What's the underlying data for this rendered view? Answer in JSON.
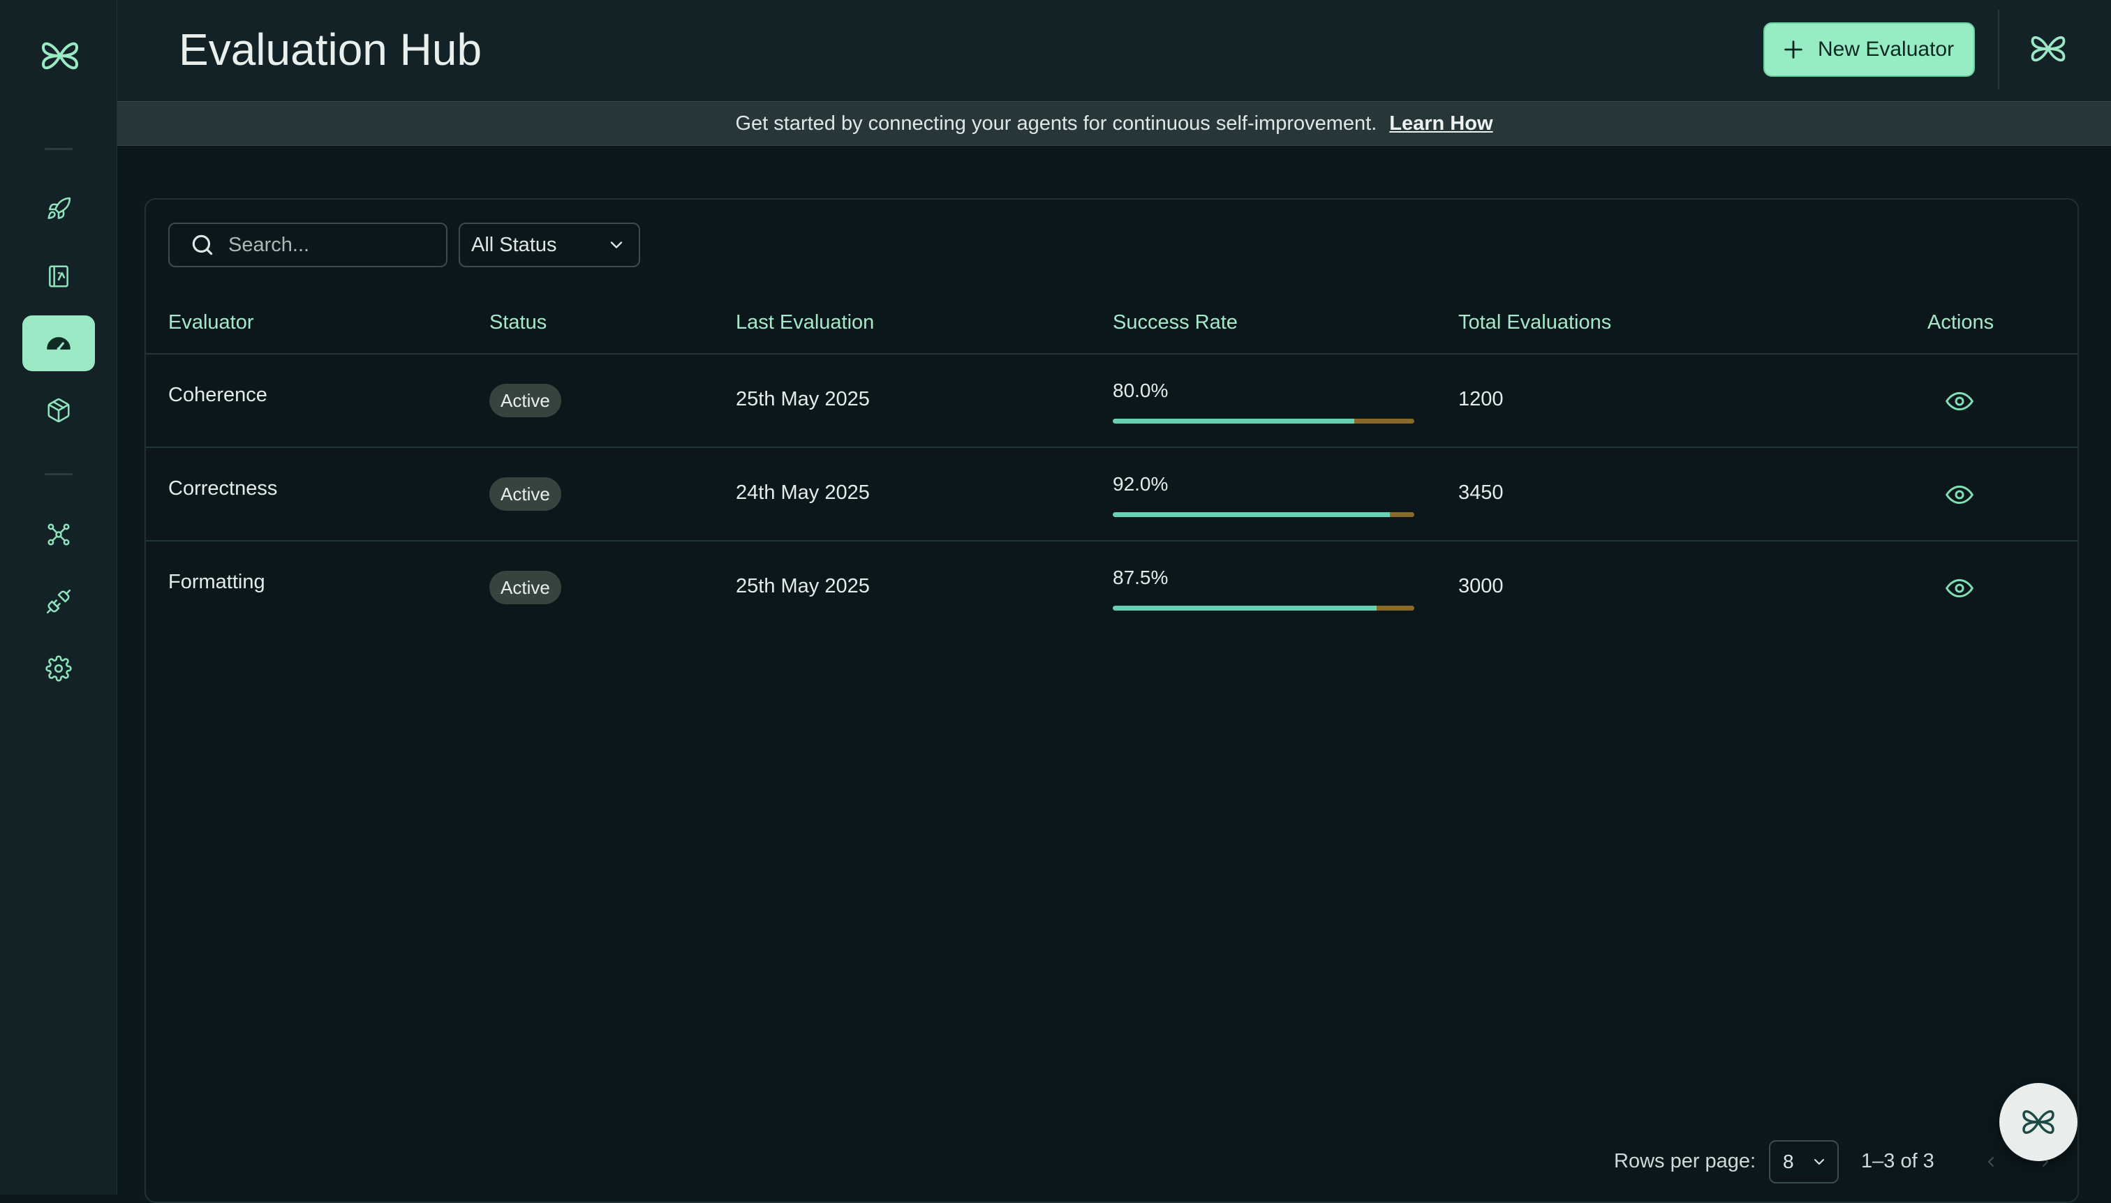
{
  "header": {
    "title": "Evaluation Hub",
    "new_button_label": "New Evaluator"
  },
  "banner": {
    "text": "Get started by connecting your agents for continuous self-improvement.",
    "link_label": "Learn How"
  },
  "sidebar": {
    "items": [
      {
        "name": "rocket",
        "icon": "rocket-icon",
        "active": false
      },
      {
        "name": "notebook",
        "icon": "notebook-icon",
        "active": false
      },
      {
        "name": "evaluation",
        "icon": "gauge-icon",
        "active": true
      },
      {
        "name": "packages",
        "icon": "cube-icon",
        "active": false
      },
      {
        "name": "graph",
        "icon": "nodes-icon",
        "active": false
      },
      {
        "name": "integrations",
        "icon": "plug-icon",
        "active": false
      },
      {
        "name": "settings",
        "icon": "gear-icon",
        "active": false
      }
    ]
  },
  "filters": {
    "search_placeholder": "Search...",
    "status_value": "All Status"
  },
  "table": {
    "headers": {
      "evaluator": "Evaluator",
      "status": "Status",
      "last_evaluation": "Last Evaluation",
      "success_rate": "Success Rate",
      "total_evaluations": "Total Evaluations",
      "actions": "Actions"
    },
    "rows": [
      {
        "evaluator": "Coherence",
        "status": "Active",
        "last_evaluation": "25th May 2025",
        "success_rate": "80.0%",
        "success_fraction": 0.8,
        "total": "1200"
      },
      {
        "evaluator": "Correctness",
        "status": "Active",
        "last_evaluation": "24th May 2025",
        "success_rate": "92.0%",
        "success_fraction": 0.92,
        "total": "3450"
      },
      {
        "evaluator": "Formatting",
        "status": "Active",
        "last_evaluation": "25th May 2025",
        "success_rate": "87.5%",
        "success_fraction": 0.875,
        "total": "3000"
      }
    ]
  },
  "pagination": {
    "rows_per_page_label": "Rows per page:",
    "rows_per_page_value": "8",
    "range": "1–3 of 3"
  },
  "colors": {
    "accent": "#96edc4",
    "bar_fill": "#67d1b4",
    "bar_remainder": "#8a6a28"
  }
}
